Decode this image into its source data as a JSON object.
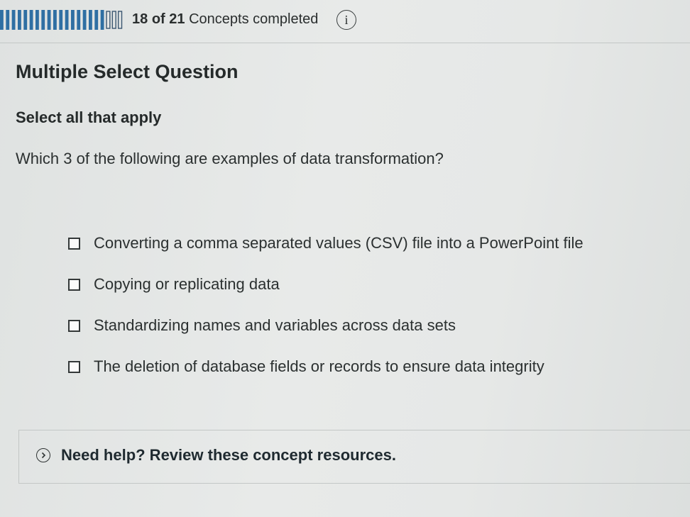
{
  "progress": {
    "completed": "18",
    "of_label": "of",
    "total": "21",
    "suffix": "Concepts completed",
    "fraction": 0.857
  },
  "info_icon": "info-icon",
  "question": {
    "type": "Multiple Select Question",
    "instruction": "Select all that apply",
    "prompt": "Which 3 of the following are examples of data transformation?",
    "options": [
      {
        "label": "Converting a comma separated values (CSV) file into a PowerPoint file",
        "checked": false
      },
      {
        "label": "Copying or replicating data",
        "checked": false
      },
      {
        "label": "Standardizing names and variables across data sets",
        "checked": false
      },
      {
        "label": "The deletion of database fields or records to ensure data integrity",
        "checked": false
      }
    ]
  },
  "help": {
    "icon": "chevron-right-circle-icon",
    "label": "Need help? Review these concept resources."
  }
}
